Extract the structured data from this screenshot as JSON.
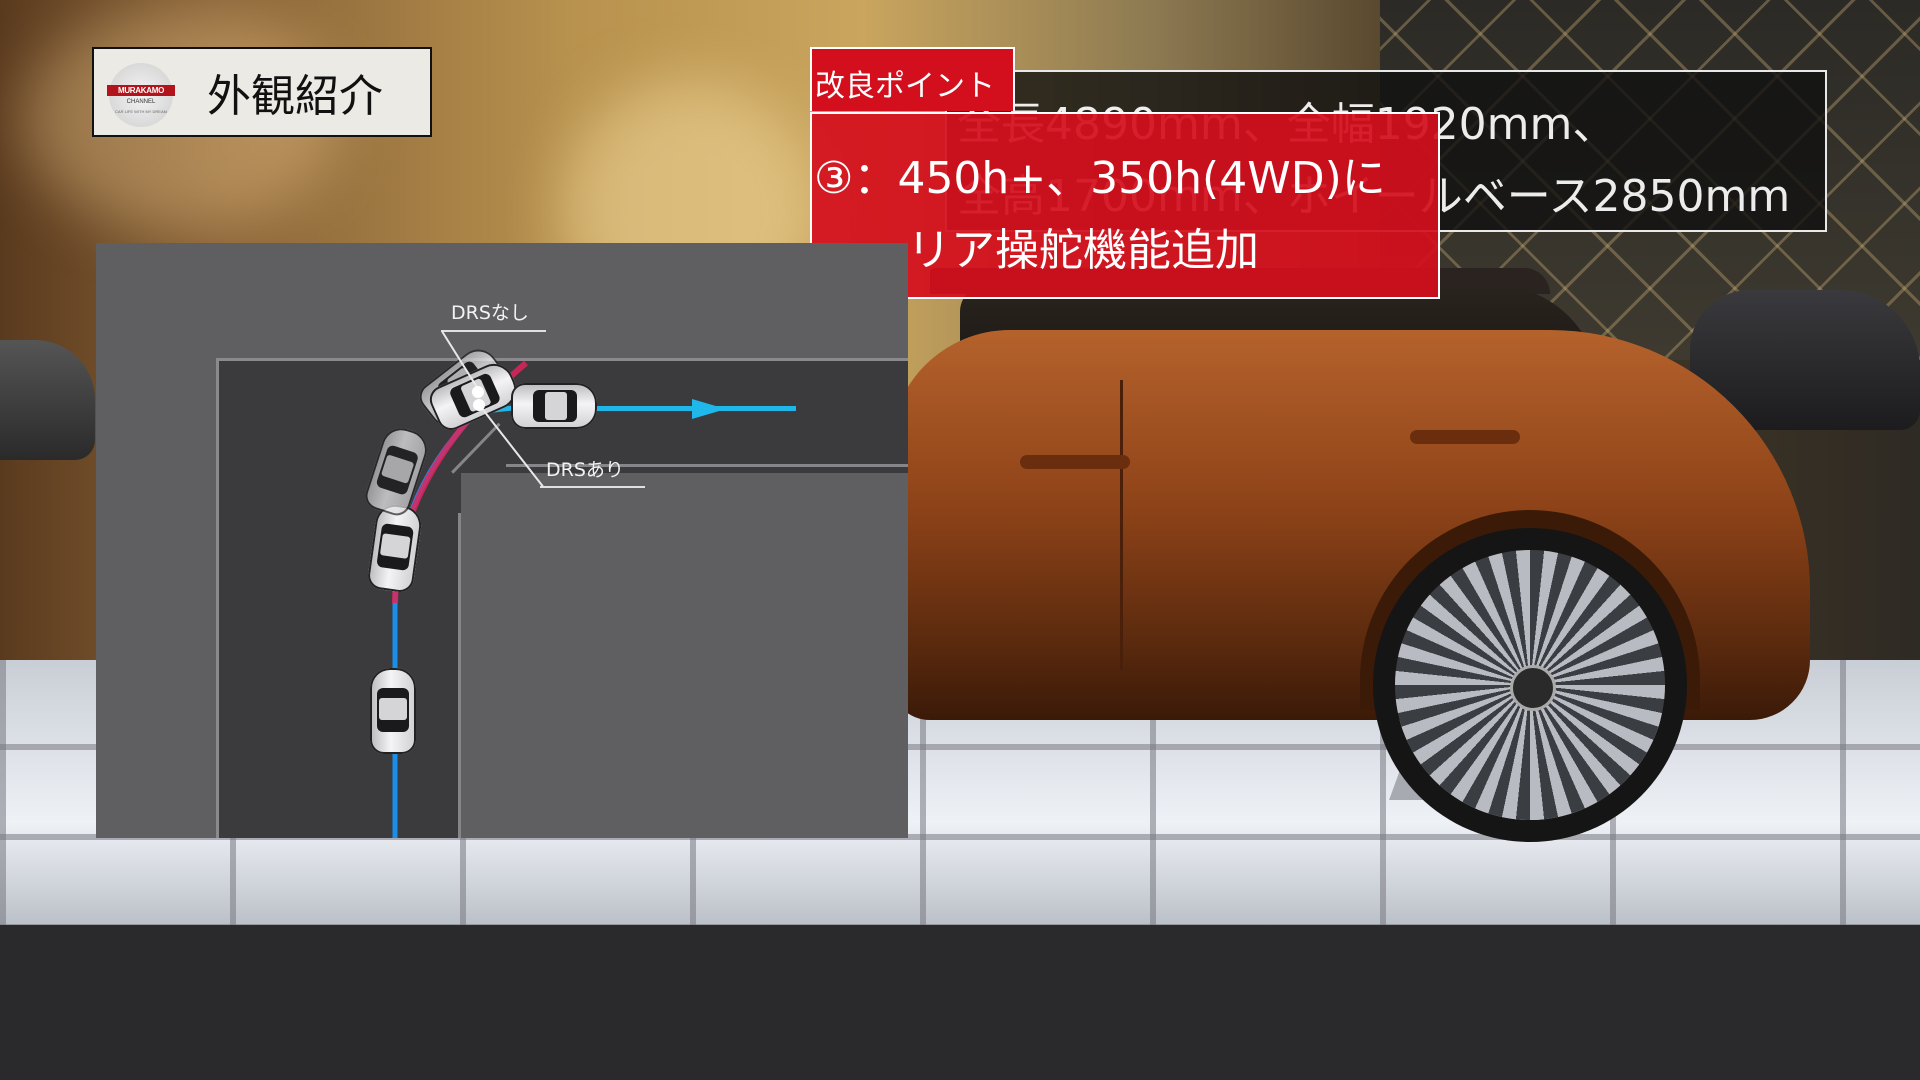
{
  "section_label": {
    "title": "外観紹介",
    "logo_text": "MURAKAMO",
    "logo_sub": "CHANNEL",
    "logo_foot": "CAR LIFE WITH MY DREAM"
  },
  "specs": {
    "line1": "全長4890mm、全幅1920mm、",
    "line2": "全高1700mm、ホイールベース2850mm"
  },
  "improvement": {
    "tab": "改良ポイント",
    "line1": "③：450h+、350h(4WD)に",
    "line2": "リア操舵機能追加"
  },
  "diagram": {
    "label_without": "DRSなし",
    "label_with": "DRSあり",
    "path_colors": {
      "with": "#1fb8ea",
      "without": "#e0245a"
    }
  },
  "colors": {
    "accent_red": "#d40f1d",
    "car_copper": "#b5622c"
  }
}
